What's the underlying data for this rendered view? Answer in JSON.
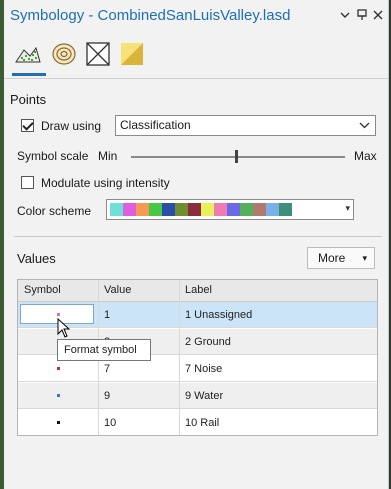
{
  "window": {
    "title": "Symbology - CombinedSanLuisValley.lasd",
    "controls": [
      "chevron-down-icon",
      "pin-icon",
      "close-icon"
    ]
  },
  "tabs": [
    {
      "name": "points-tab",
      "icon": "point-cloud-icon"
    },
    {
      "name": "contours-tab",
      "icon": "contour-icon"
    },
    {
      "name": "triangles-tab",
      "icon": "triangle-mesh-icon"
    },
    {
      "name": "surface-tab",
      "icon": "surface-icon"
    }
  ],
  "points": {
    "heading": "Points",
    "draw_using_label": "Draw using",
    "draw_using_checked": true,
    "draw_using_value": "Classification",
    "symbol_scale_label": "Symbol scale",
    "min_label": "Min",
    "max_label": "Max",
    "symbol_scale_level": 0.49,
    "modulate_label": "Modulate using intensity",
    "modulate_checked": false,
    "color_scheme_label": "Color scheme",
    "color_scheme_colors": [
      "#6fe0d6",
      "#e05de0",
      "#f59a54",
      "#46c846",
      "#2a4fa8",
      "#6f8f2e",
      "#8c2d3b",
      "#e8f05a",
      "#f07ab4",
      "#6a6ae8",
      "#55b05a",
      "#b07a6e",
      "#7ab0e8",
      "#3e8f7a"
    ]
  },
  "values": {
    "heading": "Values",
    "more_label": "More",
    "columns": [
      "Symbol",
      "Value",
      "Label"
    ],
    "rows": [
      {
        "value": "1",
        "label": "1  Unassigned",
        "color": "#d070d0",
        "selected": true
      },
      {
        "value": "2",
        "label": "2  Ground",
        "color": "#3fae3f",
        "selected": false
      },
      {
        "value": "7",
        "label": "7  Noise",
        "color": "#c83030",
        "selected": false
      },
      {
        "value": "9",
        "label": "9  Water",
        "color": "#3a78c0",
        "selected": false
      },
      {
        "value": "10",
        "label": "10  Rail",
        "color": "#111111",
        "selected": false
      }
    ]
  },
  "tooltip": "Format symbol"
}
